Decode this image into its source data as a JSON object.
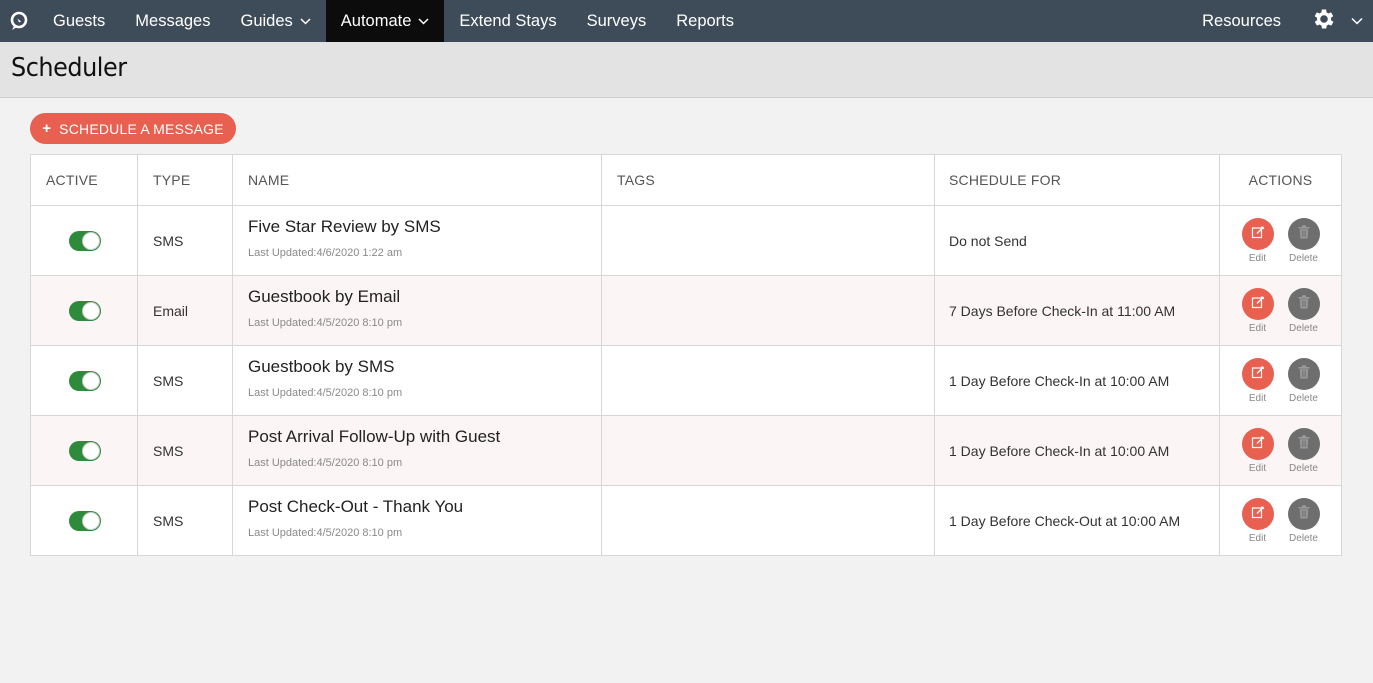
{
  "nav": {
    "items": [
      {
        "label": "Guests",
        "dropdown": false,
        "active": false,
        "name": "nav-guests"
      },
      {
        "label": "Messages",
        "dropdown": false,
        "active": false,
        "name": "nav-messages"
      },
      {
        "label": "Guides",
        "dropdown": true,
        "active": false,
        "name": "nav-guides"
      },
      {
        "label": "Automate",
        "dropdown": true,
        "active": true,
        "name": "nav-automate"
      },
      {
        "label": "Extend Stays",
        "dropdown": false,
        "active": false,
        "name": "nav-extend-stays"
      },
      {
        "label": "Surveys",
        "dropdown": false,
        "active": false,
        "name": "nav-surveys"
      },
      {
        "label": "Reports",
        "dropdown": false,
        "active": false,
        "name": "nav-reports"
      }
    ],
    "resources_label": "Resources",
    "logo_icon": "app-logo-icon",
    "settings_icon": "gear-icon"
  },
  "page": {
    "title": "Scheduler",
    "schedule_button_label": "SCHEDULE A MESSAGE"
  },
  "table": {
    "headers": {
      "active": "ACTIVE",
      "type": "TYPE",
      "name": "NAME",
      "tags": "TAGS",
      "schedule_for": "SCHEDULE FOR",
      "actions": "ACTIONS"
    },
    "edit_label": "Edit",
    "delete_label": "Delete",
    "rows": [
      {
        "active": true,
        "type": "SMS",
        "name": "Five Star Review by SMS",
        "updated": "Last Updated:4/6/2020 1:22 am",
        "tags": "",
        "schedule_for": "Do not Send"
      },
      {
        "active": true,
        "type": "Email",
        "name": "Guestbook by Email",
        "updated": "Last Updated:4/5/2020 8:10 pm",
        "tags": "",
        "schedule_for": "7 Days Before Check-In at 11:00 AM"
      },
      {
        "active": true,
        "type": "SMS",
        "name": "Guestbook by SMS",
        "updated": "Last Updated:4/5/2020 8:10 pm",
        "tags": "",
        "schedule_for": "1 Day Before Check-In at 10:00 AM"
      },
      {
        "active": true,
        "type": "SMS",
        "name": "Post Arrival Follow-Up with Guest",
        "updated": "Last Updated:4/5/2020 8:10 pm",
        "tags": "",
        "schedule_for": "1 Day Before Check-In at 10:00 AM"
      },
      {
        "active": true,
        "type": "SMS",
        "name": "Post Check-Out - Thank You",
        "updated": "Last Updated:4/5/2020 8:10 pm",
        "tags": "",
        "schedule_for": "1 Day Before Check-Out at 10:00 AM"
      }
    ]
  },
  "colors": {
    "nav_bg": "#3e4c5a",
    "nav_active_bg": "#0c0c0c",
    "accent": "#e8604f",
    "toggle_on": "#2e8b3c",
    "delete_bg": "#6e6e6e"
  }
}
